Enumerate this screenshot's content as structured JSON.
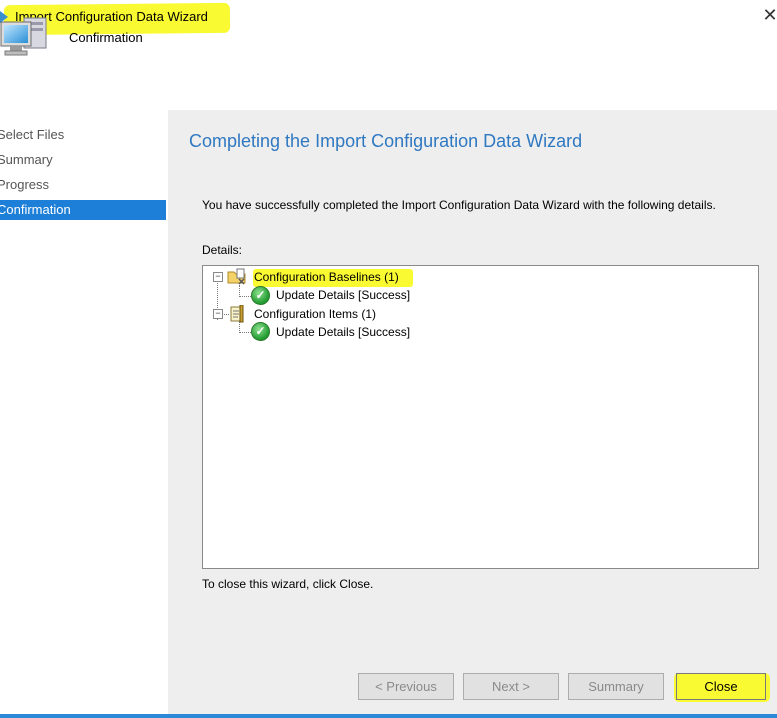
{
  "window": {
    "title": "Import Configuration Data Wizard",
    "close_glyph": "✕"
  },
  "header": {
    "title": "Confirmation",
    "icon": "computer-wizard-icon"
  },
  "nav": {
    "items": [
      {
        "label": "Select Files",
        "active": false
      },
      {
        "label": "Summary",
        "active": false
      },
      {
        "label": "Progress",
        "active": false
      },
      {
        "label": "Confirmation",
        "active": true
      }
    ]
  },
  "main": {
    "heading": "Completing the Import Configuration Data Wizard",
    "message": "You have successfully completed the Import Configuration Data Wizard with the following details.",
    "details_label": "Details:",
    "tree": [
      {
        "label": "Configuration Baselines (1)",
        "icon": "folder-baseline-icon",
        "child": "Update Details [Success]"
      },
      {
        "label": "Configuration Items (1)",
        "icon": "document-item-icon",
        "child": "Update Details [Success]"
      }
    ],
    "close_hint": "To close this wizard, click Close."
  },
  "footer": {
    "previous": "< Previous",
    "next": "Next >",
    "summary": "Summary",
    "close": "Close"
  },
  "colors": {
    "accent": "#1e7fd8",
    "heading": "#2f78c2",
    "highlight": "#fafa33",
    "success": "#1f9a2f"
  }
}
